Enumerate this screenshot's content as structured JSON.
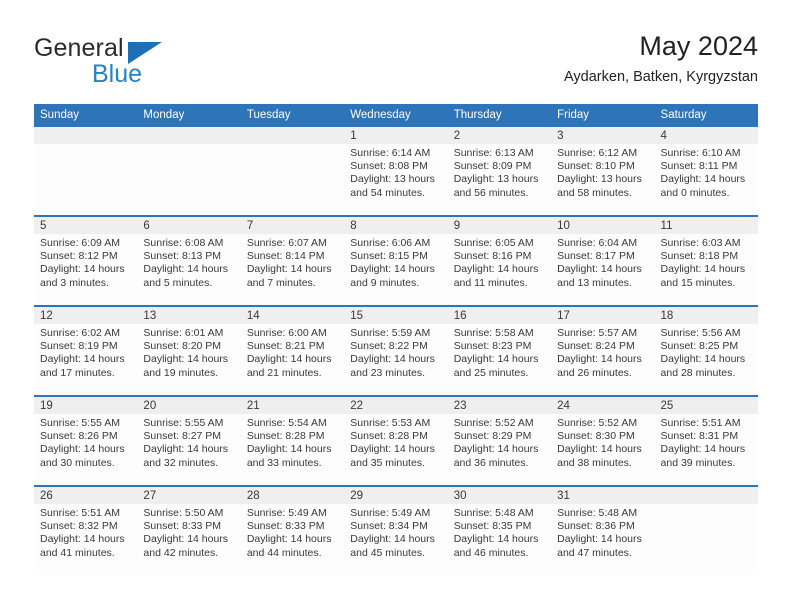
{
  "logo": {
    "word1": "General",
    "word2": "Blue",
    "triangle": "triangle-icon",
    "accent_blue": "#2383c4",
    "triangle_blue": "#1f6fb5"
  },
  "header": {
    "title": "May 2024",
    "subtitle": "Aydarken, Batken, Kyrgyzstan"
  },
  "theme": {
    "header_bg": "#2d74b8",
    "daynum_band_bg": "#efefef",
    "cell_bg": "#fdfdfd",
    "text": "#3a3a3a"
  },
  "calendar": {
    "weekday_headers": [
      "Sunday",
      "Monday",
      "Tuesday",
      "Wednesday",
      "Thursday",
      "Friday",
      "Saturday"
    ],
    "weeks": [
      [
        {
          "day": "",
          "sunrise": "",
          "sunset": "",
          "daylight": "",
          "empty": true
        },
        {
          "day": "",
          "sunrise": "",
          "sunset": "",
          "daylight": "",
          "empty": true
        },
        {
          "day": "",
          "sunrise": "",
          "sunset": "",
          "daylight": "",
          "empty": true
        },
        {
          "day": "1",
          "sunrise": "Sunrise: 6:14 AM",
          "sunset": "Sunset: 8:08 PM",
          "daylight": "Daylight: 13 hours and 54 minutes.",
          "empty": false
        },
        {
          "day": "2",
          "sunrise": "Sunrise: 6:13 AM",
          "sunset": "Sunset: 8:09 PM",
          "daylight": "Daylight: 13 hours and 56 minutes.",
          "empty": false
        },
        {
          "day": "3",
          "sunrise": "Sunrise: 6:12 AM",
          "sunset": "Sunset: 8:10 PM",
          "daylight": "Daylight: 13 hours and 58 minutes.",
          "empty": false
        },
        {
          "day": "4",
          "sunrise": "Sunrise: 6:10 AM",
          "sunset": "Sunset: 8:11 PM",
          "daylight": "Daylight: 14 hours and 0 minutes.",
          "empty": false
        }
      ],
      [
        {
          "day": "5",
          "sunrise": "Sunrise: 6:09 AM",
          "sunset": "Sunset: 8:12 PM",
          "daylight": "Daylight: 14 hours and 3 minutes.",
          "empty": false
        },
        {
          "day": "6",
          "sunrise": "Sunrise: 6:08 AM",
          "sunset": "Sunset: 8:13 PM",
          "daylight": "Daylight: 14 hours and 5 minutes.",
          "empty": false
        },
        {
          "day": "7",
          "sunrise": "Sunrise: 6:07 AM",
          "sunset": "Sunset: 8:14 PM",
          "daylight": "Daylight: 14 hours and 7 minutes.",
          "empty": false
        },
        {
          "day": "8",
          "sunrise": "Sunrise: 6:06 AM",
          "sunset": "Sunset: 8:15 PM",
          "daylight": "Daylight: 14 hours and 9 minutes.",
          "empty": false
        },
        {
          "day": "9",
          "sunrise": "Sunrise: 6:05 AM",
          "sunset": "Sunset: 8:16 PM",
          "daylight": "Daylight: 14 hours and 11 minutes.",
          "empty": false
        },
        {
          "day": "10",
          "sunrise": "Sunrise: 6:04 AM",
          "sunset": "Sunset: 8:17 PM",
          "daylight": "Daylight: 14 hours and 13 minutes.",
          "empty": false
        },
        {
          "day": "11",
          "sunrise": "Sunrise: 6:03 AM",
          "sunset": "Sunset: 8:18 PM",
          "daylight": "Daylight: 14 hours and 15 minutes.",
          "empty": false
        }
      ],
      [
        {
          "day": "12",
          "sunrise": "Sunrise: 6:02 AM",
          "sunset": "Sunset: 8:19 PM",
          "daylight": "Daylight: 14 hours and 17 minutes.",
          "empty": false
        },
        {
          "day": "13",
          "sunrise": "Sunrise: 6:01 AM",
          "sunset": "Sunset: 8:20 PM",
          "daylight": "Daylight: 14 hours and 19 minutes.",
          "empty": false
        },
        {
          "day": "14",
          "sunrise": "Sunrise: 6:00 AM",
          "sunset": "Sunset: 8:21 PM",
          "daylight": "Daylight: 14 hours and 21 minutes.",
          "empty": false
        },
        {
          "day": "15",
          "sunrise": "Sunrise: 5:59 AM",
          "sunset": "Sunset: 8:22 PM",
          "daylight": "Daylight: 14 hours and 23 minutes.",
          "empty": false
        },
        {
          "day": "16",
          "sunrise": "Sunrise: 5:58 AM",
          "sunset": "Sunset: 8:23 PM",
          "daylight": "Daylight: 14 hours and 25 minutes.",
          "empty": false
        },
        {
          "day": "17",
          "sunrise": "Sunrise: 5:57 AM",
          "sunset": "Sunset: 8:24 PM",
          "daylight": "Daylight: 14 hours and 26 minutes.",
          "empty": false
        },
        {
          "day": "18",
          "sunrise": "Sunrise: 5:56 AM",
          "sunset": "Sunset: 8:25 PM",
          "daylight": "Daylight: 14 hours and 28 minutes.",
          "empty": false
        }
      ],
      [
        {
          "day": "19",
          "sunrise": "Sunrise: 5:55 AM",
          "sunset": "Sunset: 8:26 PM",
          "daylight": "Daylight: 14 hours and 30 minutes.",
          "empty": false
        },
        {
          "day": "20",
          "sunrise": "Sunrise: 5:55 AM",
          "sunset": "Sunset: 8:27 PM",
          "daylight": "Daylight: 14 hours and 32 minutes.",
          "empty": false
        },
        {
          "day": "21",
          "sunrise": "Sunrise: 5:54 AM",
          "sunset": "Sunset: 8:28 PM",
          "daylight": "Daylight: 14 hours and 33 minutes.",
          "empty": false
        },
        {
          "day": "22",
          "sunrise": "Sunrise: 5:53 AM",
          "sunset": "Sunset: 8:28 PM",
          "daylight": "Daylight: 14 hours and 35 minutes.",
          "empty": false
        },
        {
          "day": "23",
          "sunrise": "Sunrise: 5:52 AM",
          "sunset": "Sunset: 8:29 PM",
          "daylight": "Daylight: 14 hours and 36 minutes.",
          "empty": false
        },
        {
          "day": "24",
          "sunrise": "Sunrise: 5:52 AM",
          "sunset": "Sunset: 8:30 PM",
          "daylight": "Daylight: 14 hours and 38 minutes.",
          "empty": false
        },
        {
          "day": "25",
          "sunrise": "Sunrise: 5:51 AM",
          "sunset": "Sunset: 8:31 PM",
          "daylight": "Daylight: 14 hours and 39 minutes.",
          "empty": false
        }
      ],
      [
        {
          "day": "26",
          "sunrise": "Sunrise: 5:51 AM",
          "sunset": "Sunset: 8:32 PM",
          "daylight": "Daylight: 14 hours and 41 minutes.",
          "empty": false
        },
        {
          "day": "27",
          "sunrise": "Sunrise: 5:50 AM",
          "sunset": "Sunset: 8:33 PM",
          "daylight": "Daylight: 14 hours and 42 minutes.",
          "empty": false
        },
        {
          "day": "28",
          "sunrise": "Sunrise: 5:49 AM",
          "sunset": "Sunset: 8:33 PM",
          "daylight": "Daylight: 14 hours and 44 minutes.",
          "empty": false
        },
        {
          "day": "29",
          "sunrise": "Sunrise: 5:49 AM",
          "sunset": "Sunset: 8:34 PM",
          "daylight": "Daylight: 14 hours and 45 minutes.",
          "empty": false
        },
        {
          "day": "30",
          "sunrise": "Sunrise: 5:48 AM",
          "sunset": "Sunset: 8:35 PM",
          "daylight": "Daylight: 14 hours and 46 minutes.",
          "empty": false
        },
        {
          "day": "31",
          "sunrise": "Sunrise: 5:48 AM",
          "sunset": "Sunset: 8:36 PM",
          "daylight": "Daylight: 14 hours and 47 minutes.",
          "empty": false
        },
        {
          "day": "",
          "sunrise": "",
          "sunset": "",
          "daylight": "",
          "empty": true
        }
      ]
    ]
  }
}
